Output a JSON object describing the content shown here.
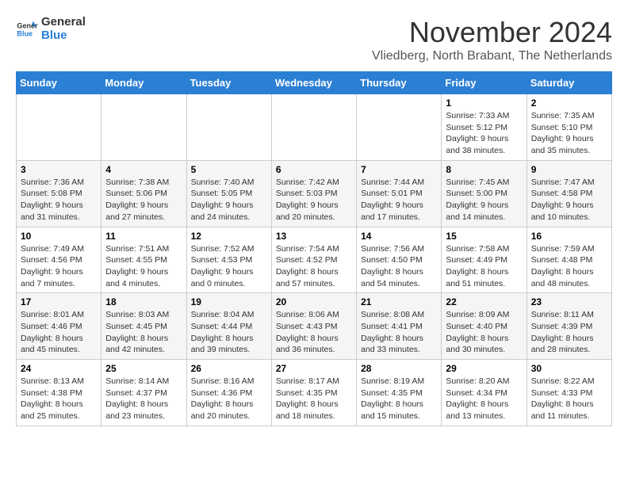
{
  "logo": {
    "text1": "General",
    "text2": "Blue"
  },
  "title": "November 2024",
  "location": "Vliedberg, North Brabant, The Netherlands",
  "weekdays": [
    "Sunday",
    "Monday",
    "Tuesday",
    "Wednesday",
    "Thursday",
    "Friday",
    "Saturday"
  ],
  "weeks": [
    [
      {
        "day": "",
        "info": ""
      },
      {
        "day": "",
        "info": ""
      },
      {
        "day": "",
        "info": ""
      },
      {
        "day": "",
        "info": ""
      },
      {
        "day": "",
        "info": ""
      },
      {
        "day": "1",
        "info": "Sunrise: 7:33 AM\nSunset: 5:12 PM\nDaylight: 9 hours and 38 minutes."
      },
      {
        "day": "2",
        "info": "Sunrise: 7:35 AM\nSunset: 5:10 PM\nDaylight: 9 hours and 35 minutes."
      }
    ],
    [
      {
        "day": "3",
        "info": "Sunrise: 7:36 AM\nSunset: 5:08 PM\nDaylight: 9 hours and 31 minutes."
      },
      {
        "day": "4",
        "info": "Sunrise: 7:38 AM\nSunset: 5:06 PM\nDaylight: 9 hours and 27 minutes."
      },
      {
        "day": "5",
        "info": "Sunrise: 7:40 AM\nSunset: 5:05 PM\nDaylight: 9 hours and 24 minutes."
      },
      {
        "day": "6",
        "info": "Sunrise: 7:42 AM\nSunset: 5:03 PM\nDaylight: 9 hours and 20 minutes."
      },
      {
        "day": "7",
        "info": "Sunrise: 7:44 AM\nSunset: 5:01 PM\nDaylight: 9 hours and 17 minutes."
      },
      {
        "day": "8",
        "info": "Sunrise: 7:45 AM\nSunset: 5:00 PM\nDaylight: 9 hours and 14 minutes."
      },
      {
        "day": "9",
        "info": "Sunrise: 7:47 AM\nSunset: 4:58 PM\nDaylight: 9 hours and 10 minutes."
      }
    ],
    [
      {
        "day": "10",
        "info": "Sunrise: 7:49 AM\nSunset: 4:56 PM\nDaylight: 9 hours and 7 minutes."
      },
      {
        "day": "11",
        "info": "Sunrise: 7:51 AM\nSunset: 4:55 PM\nDaylight: 9 hours and 4 minutes."
      },
      {
        "day": "12",
        "info": "Sunrise: 7:52 AM\nSunset: 4:53 PM\nDaylight: 9 hours and 0 minutes."
      },
      {
        "day": "13",
        "info": "Sunrise: 7:54 AM\nSunset: 4:52 PM\nDaylight: 8 hours and 57 minutes."
      },
      {
        "day": "14",
        "info": "Sunrise: 7:56 AM\nSunset: 4:50 PM\nDaylight: 8 hours and 54 minutes."
      },
      {
        "day": "15",
        "info": "Sunrise: 7:58 AM\nSunset: 4:49 PM\nDaylight: 8 hours and 51 minutes."
      },
      {
        "day": "16",
        "info": "Sunrise: 7:59 AM\nSunset: 4:48 PM\nDaylight: 8 hours and 48 minutes."
      }
    ],
    [
      {
        "day": "17",
        "info": "Sunrise: 8:01 AM\nSunset: 4:46 PM\nDaylight: 8 hours and 45 minutes."
      },
      {
        "day": "18",
        "info": "Sunrise: 8:03 AM\nSunset: 4:45 PM\nDaylight: 8 hours and 42 minutes."
      },
      {
        "day": "19",
        "info": "Sunrise: 8:04 AM\nSunset: 4:44 PM\nDaylight: 8 hours and 39 minutes."
      },
      {
        "day": "20",
        "info": "Sunrise: 8:06 AM\nSunset: 4:43 PM\nDaylight: 8 hours and 36 minutes."
      },
      {
        "day": "21",
        "info": "Sunrise: 8:08 AM\nSunset: 4:41 PM\nDaylight: 8 hours and 33 minutes."
      },
      {
        "day": "22",
        "info": "Sunrise: 8:09 AM\nSunset: 4:40 PM\nDaylight: 8 hours and 30 minutes."
      },
      {
        "day": "23",
        "info": "Sunrise: 8:11 AM\nSunset: 4:39 PM\nDaylight: 8 hours and 28 minutes."
      }
    ],
    [
      {
        "day": "24",
        "info": "Sunrise: 8:13 AM\nSunset: 4:38 PM\nDaylight: 8 hours and 25 minutes."
      },
      {
        "day": "25",
        "info": "Sunrise: 8:14 AM\nSunset: 4:37 PM\nDaylight: 8 hours and 23 minutes."
      },
      {
        "day": "26",
        "info": "Sunrise: 8:16 AM\nSunset: 4:36 PM\nDaylight: 8 hours and 20 minutes."
      },
      {
        "day": "27",
        "info": "Sunrise: 8:17 AM\nSunset: 4:35 PM\nDaylight: 8 hours and 18 minutes."
      },
      {
        "day": "28",
        "info": "Sunrise: 8:19 AM\nSunset: 4:35 PM\nDaylight: 8 hours and 15 minutes."
      },
      {
        "day": "29",
        "info": "Sunrise: 8:20 AM\nSunset: 4:34 PM\nDaylight: 8 hours and 13 minutes."
      },
      {
        "day": "30",
        "info": "Sunrise: 8:22 AM\nSunset: 4:33 PM\nDaylight: 8 hours and 11 minutes."
      }
    ]
  ]
}
